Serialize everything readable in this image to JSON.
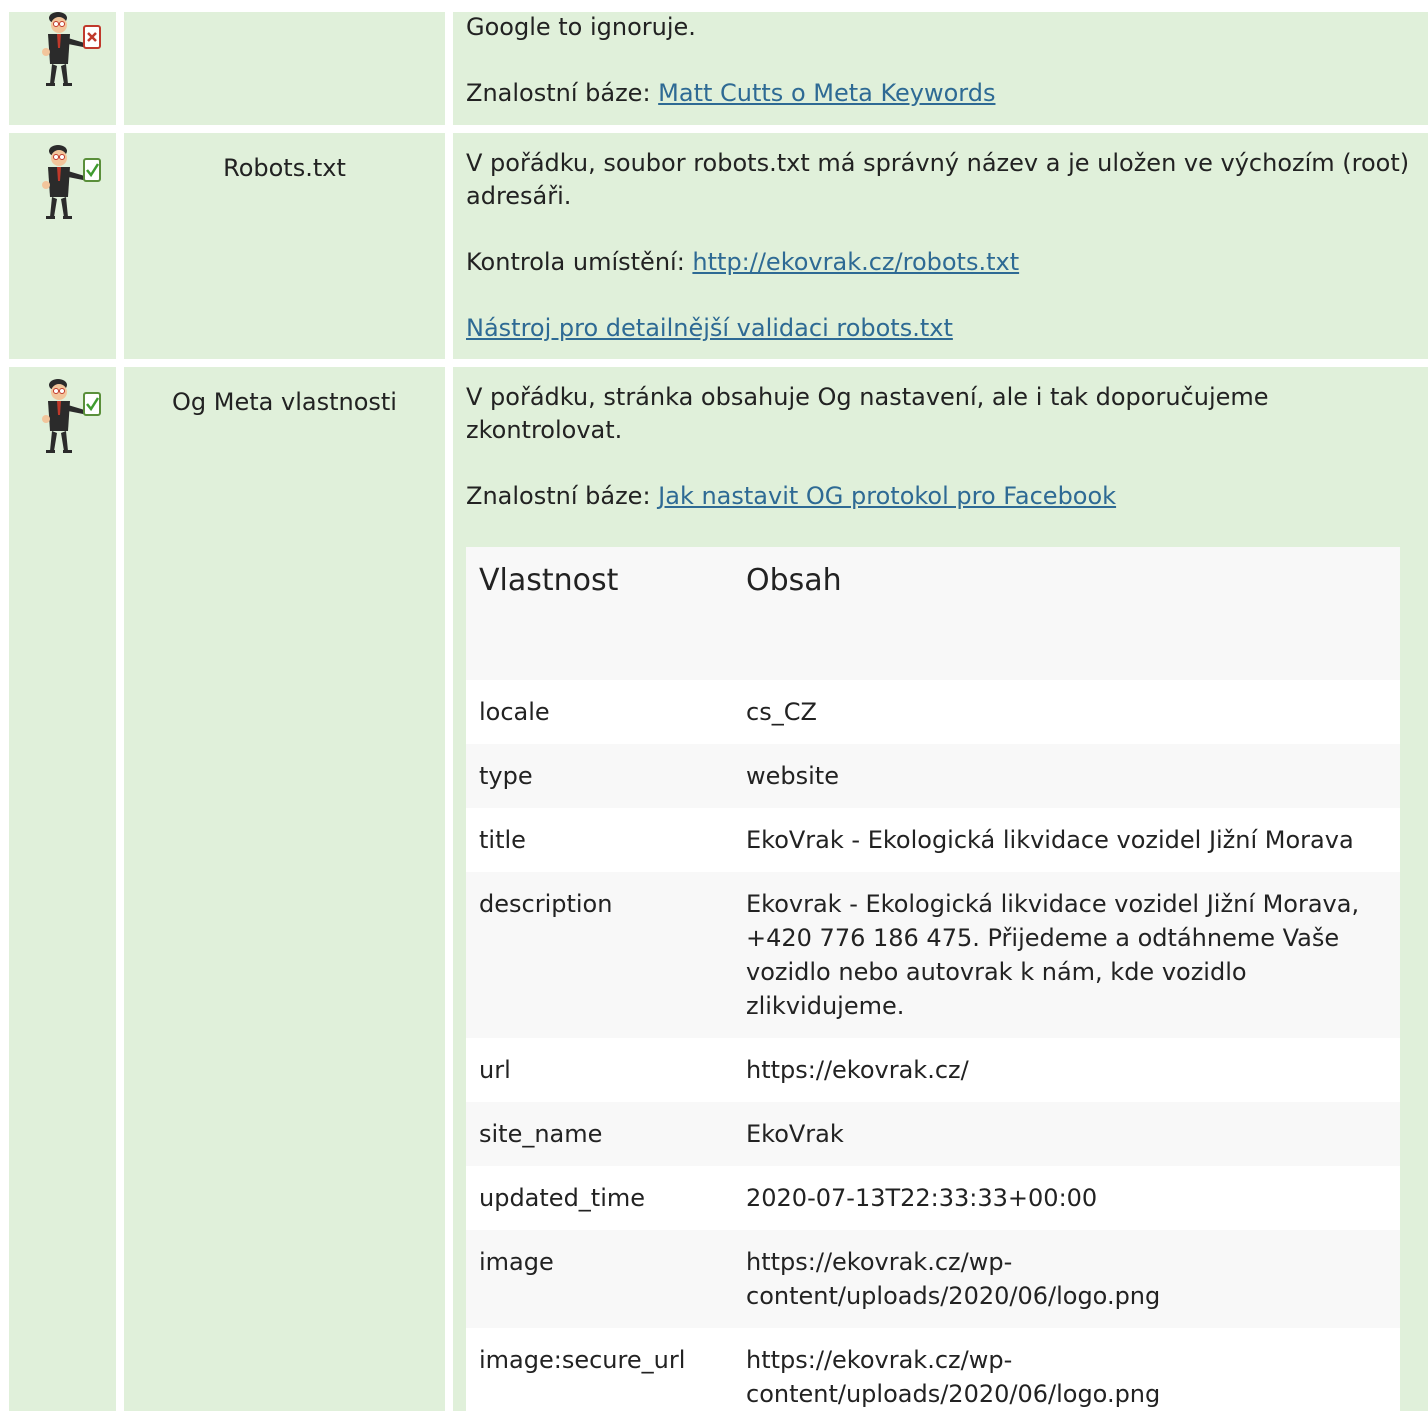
{
  "rows": [
    {
      "status": "fail",
      "name": "",
      "desc": {
        "line1": "Google to ignoruje.",
        "kb_label": "Znalostní báze: ",
        "kb_link": "Matt Cutts o Meta Keywords"
      }
    },
    {
      "status": "ok",
      "name": "Robots.txt",
      "desc": {
        "text": "V pořádku, soubor robots.txt má správný název a je uložen ve výchozím (root) adresáři.",
        "check_label": "Kontrola umístění: ",
        "check_link": "http://ekovrak.cz/robots.txt",
        "tool_link": "Nástroj pro detailnější validaci robots.txt"
      }
    },
    {
      "status": "ok",
      "name": "Og Meta vlastnosti",
      "desc": {
        "text": "V pořádku, stránka obsahuje Og nastavení, ale i tak doporučujeme zkontrolovat.",
        "kb_label": "Znalostní báze: ",
        "kb_link": "Jak nastavit OG protokol pro Facebook"
      }
    }
  ],
  "og_table": {
    "headers": [
      "Vlastnost",
      "Obsah"
    ],
    "rows": [
      {
        "property": "locale",
        "content": "cs_CZ"
      },
      {
        "property": "type",
        "content": "website"
      },
      {
        "property": "title",
        "content": "EkoVrak - Ekologická likvidace vozidel Jižní Morava"
      },
      {
        "property": "description",
        "content": "Ekovrak - Ekologická likvidace vozidel Jižní Morava, +420 776 186 475. Přijedeme a odtáhneme Vaše vozidlo nebo autovrak k nám, kde vozidlo zlikvidujeme."
      },
      {
        "property": "url",
        "content": "https://ekovrak.cz/"
      },
      {
        "property": "site_name",
        "content": "EkoVrak"
      },
      {
        "property": "updated_time",
        "content": "2020-07-13T22:33:33+00:00"
      },
      {
        "property": "image",
        "content": "https://ekovrak.cz/wp-content/uploads/2020/06/logo.png"
      },
      {
        "property": "image:secure_url",
        "content": "https://ekovrak.cz/wp-content/uploads/2020/06/logo.png"
      }
    ]
  },
  "icons": {
    "fail": "businessman-fail-clipboard-icon",
    "ok": "businessman-ok-clipboard-icon"
  },
  "colors": {
    "row_bg": "#e0f0da",
    "link": "#2e6a94",
    "table_alt": "#f8f8f8"
  }
}
